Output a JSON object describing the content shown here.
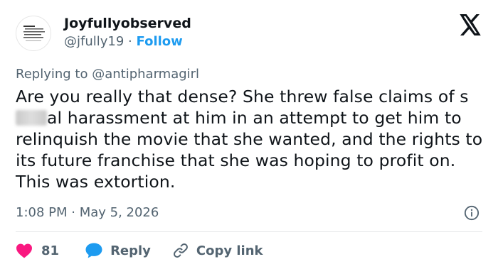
{
  "author": {
    "display_name": "Joyfullyobserved",
    "handle": "@jfully19",
    "separator": "·",
    "follow_label": "Follow"
  },
  "reply_context": {
    "prefix": "Replying to",
    "mention": "@antipharmagirl"
  },
  "tweet": {
    "text_before": "Are you really that dense? She threw false claims of s",
    "text_after": "al harassment at him in an attempt to get him to relinquish the movie that she wanted, and the rights to its future franchise that she was hoping to profit on. This was extortion.",
    "timestamp": "1:08 PM · May 5, 2026"
  },
  "actions": {
    "like_count": "81",
    "reply_label": "Reply",
    "copy_link_label": "Copy link"
  },
  "colors": {
    "like": "#f91880",
    "reply": "#1d9bf0",
    "link_icon": "#536471",
    "follow": "#1d9bf0",
    "secondary_text": "#536471"
  },
  "icons": {
    "logo": "x-logo-icon",
    "info": "info-icon",
    "like": "heart-icon",
    "reply": "speech-bubble-icon",
    "copy_link": "link-icon"
  }
}
